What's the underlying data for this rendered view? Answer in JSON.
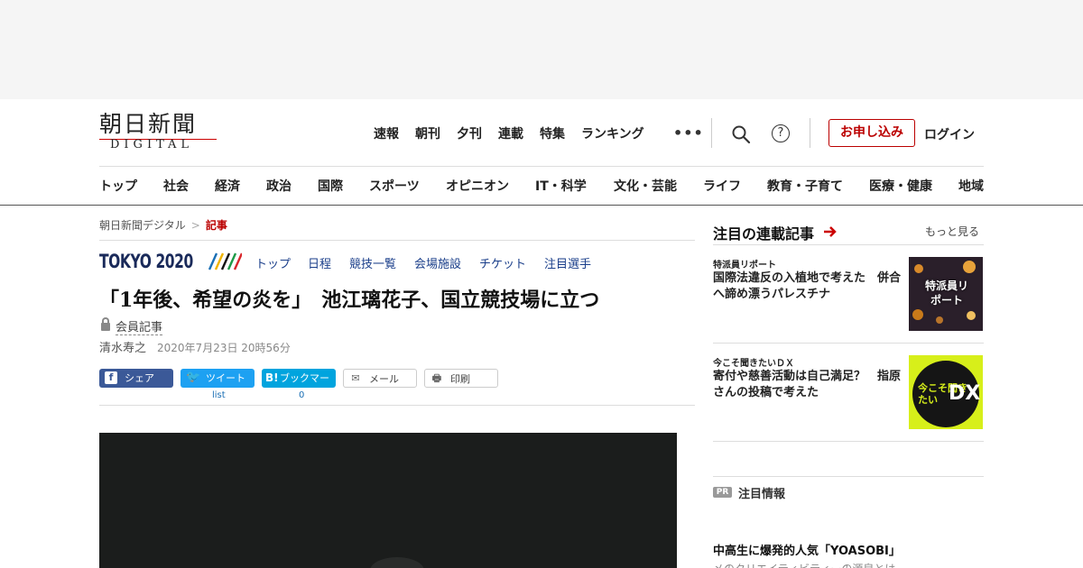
{
  "logo": {
    "main": "朝日新聞",
    "sub": "DIGITAL"
  },
  "topnav": [
    "速報",
    "朝刊",
    "夕刊",
    "連載",
    "特集",
    "ランキング"
  ],
  "header": {
    "more": "•••",
    "help": "?",
    "signup": "お申し込み",
    "login": "ログイン"
  },
  "catnav": [
    "トップ",
    "社会",
    "経済",
    "政治",
    "国際",
    "スポーツ",
    "オピニオン",
    "IT・科学",
    "文化・芸能",
    "ライフ",
    "教育・子育て",
    "医療・健康",
    "地域"
  ],
  "breadcrumb": {
    "home": "朝日新聞デジタル",
    "sep": ">",
    "current": "記事"
  },
  "tokyo": {
    "logo": "TOKYO 2020",
    "nav": [
      "トップ",
      "日程",
      "競技一覧",
      "会場施設",
      "チケット",
      "注目選手"
    ],
    "stripe_colors": [
      "#1a6fb5",
      "#f0b400",
      "#111111",
      "#1e9b48",
      "#d9262b"
    ]
  },
  "article": {
    "headline": "「1年後、希望の炎を」　池江璃花子、国立競技場に立つ",
    "member_label": "会員記事",
    "author": "清水寿之",
    "date": "2020年7月23日 20時56分"
  },
  "share": {
    "facebook": {
      "icon": "f",
      "label": "シェア"
    },
    "twitter": {
      "icon": "🐦",
      "label": "ツイート",
      "count": "list"
    },
    "hatena": {
      "icon": "B!",
      "label": "ブックマーク",
      "count": "0"
    },
    "mail": {
      "icon": "✉",
      "label": "メール"
    },
    "print": {
      "icon": "🖶",
      "label": "印刷"
    }
  },
  "sidebar": {
    "title": "注目の連載記事",
    "more": "もっと見る",
    "features": [
      {
        "tag": "特派員リポート",
        "title": "国際法違反の入植地で考えた　併合へ諦め漂うパレスチナ",
        "thumb_text": "特派員リポート"
      },
      {
        "tag": "今こそ聞きたいＤＸ",
        "title": "寄付や慈善活動は自己満足？　指原さんの投稿で考えた",
        "thumb_text": "今こそ聞きたい",
        "thumb_dx": "DX"
      }
    ],
    "pr_badge": "PR",
    "pr_label": "注目情報",
    "pr_item": "中高生に爆発的人気「YOASOBI」",
    "pr_sub": "メのクリエイティビティーの源泉とは"
  },
  "colors": {
    "accent": "#b00000",
    "tokyo_navy": "#1a2a5a",
    "facebook": "#3b5998",
    "twitter": "#1da1f2",
    "hatena": "#00a4de"
  }
}
